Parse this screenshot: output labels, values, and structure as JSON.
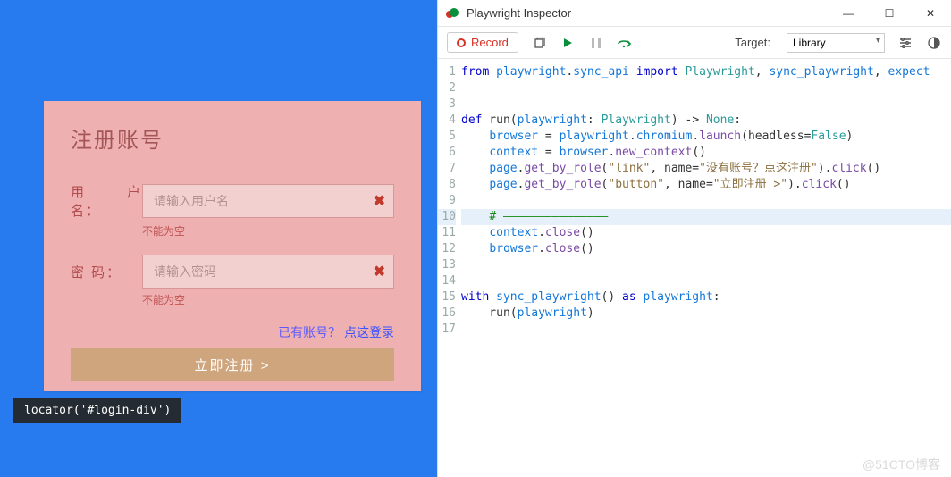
{
  "browser": {
    "form": {
      "title": "注册账号",
      "username_label": "用 户 名：",
      "username_placeholder": "请输入用户名",
      "password_label": "密    码：",
      "password_placeholder": "请输入密码",
      "error_empty": "不能为空",
      "login_link_prefix": "已有账号？",
      "login_link_action": "点这登录",
      "submit_label": "立即注册 >"
    },
    "locator_tip": "locator('#login-div')"
  },
  "inspector": {
    "title": "Playwright Inspector",
    "toolbar": {
      "record_label": "Record",
      "target_label": "Target:",
      "target_value": "Library"
    },
    "code_lines": [
      "from playwright.sync_api import Playwright, sync_playwright, expect",
      "",
      "",
      "def run(playwright: Playwright) -> None:",
      "    browser = playwright.chromium.launch(headless=False)",
      "    context = browser.new_context()",
      "    page.get_by_role(\"link\", name=\"没有账号？点这注册\").click()",
      "    page.get_by_role(\"button\", name=\"立即注册 >\").click()",
      "",
      "    # ———————————————",
      "    context.close()",
      "    browser.close()",
      "",
      "",
      "with sync_playwright() as playwright:",
      "    run(playwright)",
      ""
    ],
    "highlight_line": 10
  },
  "watermark": "@51CTO博客"
}
